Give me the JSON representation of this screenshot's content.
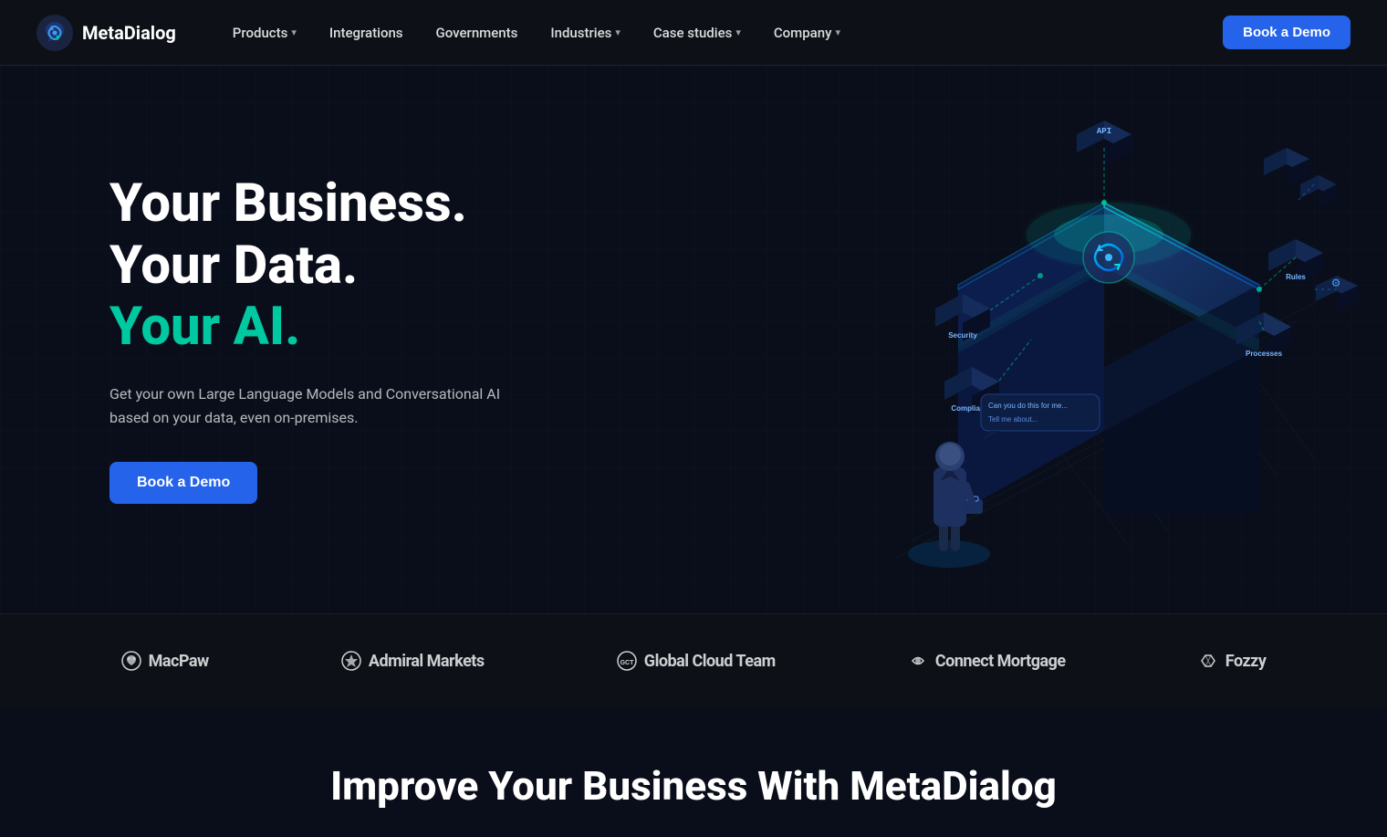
{
  "nav": {
    "logo_text": "MetaDialog",
    "items": [
      {
        "label": "Products",
        "has_dropdown": true
      },
      {
        "label": "Integrations",
        "has_dropdown": false
      },
      {
        "label": "Governments",
        "has_dropdown": false
      },
      {
        "label": "Industries",
        "has_dropdown": true
      },
      {
        "label": "Case studies",
        "has_dropdown": true
      },
      {
        "label": "Company",
        "has_dropdown": true
      }
    ],
    "cta_label": "Book a Demo"
  },
  "hero": {
    "line1": "Your Business.",
    "line2": "Your Data.",
    "line3": "Your AI.",
    "subtitle": "Get your own Large Language Models and Conversational AI based on your data, even on-premises.",
    "cta_label": "Book a Demo",
    "illustration_labels": {
      "security": "Security",
      "rules": "Rules",
      "compliance": "Compliance",
      "processes": "Processes",
      "chat1": "Can you do this for me...",
      "chat2": "Tell me about..."
    }
  },
  "logos": [
    {
      "name": "MacPaw",
      "icon": "paw"
    },
    {
      "name": "Admiral Markets",
      "icon": "admiral"
    },
    {
      "name": "Global Cloud Team",
      "icon": "gct"
    },
    {
      "name": "Connect Mortgage",
      "icon": "connect"
    },
    {
      "name": "Fozzy",
      "icon": "fozzy"
    }
  ],
  "bottom": {
    "title": "Improve Your Business With MetaDialog"
  }
}
